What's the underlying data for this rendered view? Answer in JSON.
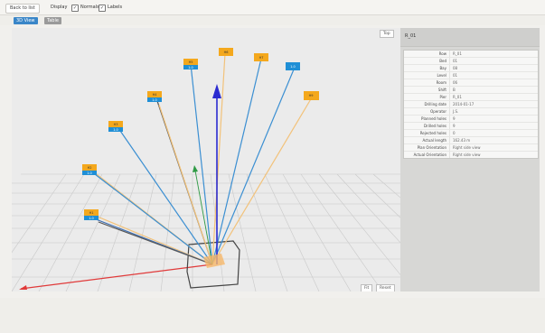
{
  "toolbar": {
    "back_label": "Back to list",
    "display_label": "Display",
    "checkbox_1": "Normals",
    "checkbox_2": "Labels"
  },
  "tabs": [
    {
      "label": "3D View"
    },
    {
      "label": "Table"
    }
  ],
  "viewport": {
    "corner_button": "Top",
    "bottom_buttons": [
      "Fit",
      "Reset"
    ]
  },
  "properties": {
    "header_title": "R_01",
    "rows": [
      {
        "k": "Row",
        "v": "R_01"
      },
      {
        "k": "Bed",
        "v": "01"
      },
      {
        "k": "Bay",
        "v": "08"
      },
      {
        "k": "Level",
        "v": "01"
      },
      {
        "k": "Room",
        "v": "06"
      },
      {
        "k": "Shift",
        "v": "B"
      },
      {
        "k": "Pier",
        "v": "R_01"
      },
      {
        "k": "Drilling date",
        "v": "2014-01-17"
      },
      {
        "k": "Operator",
        "v": "J.S."
      },
      {
        "k": "Planned holes",
        "v": "9"
      },
      {
        "k": "Drilled holes",
        "v": "9"
      },
      {
        "k": "Rejected holes",
        "v": "0"
      },
      {
        "k": "Actual length",
        "v": "162.43 m"
      },
      {
        "k": "Plan Orientation",
        "v": "Right side view"
      },
      {
        "k": "Actual Orientation",
        "v": "Right side view"
      }
    ]
  },
  "holes": [
    {
      "top": "H1",
      "bot": "1.0"
    },
    {
      "top": "H2",
      "bot": "1.0"
    },
    {
      "top": "H3",
      "bot": "1.0"
    },
    {
      "top": "H4",
      "bot": "1.0"
    },
    {
      "top": "H5",
      "bot": "1.0"
    },
    {
      "top": "H6",
      "bot": ""
    },
    {
      "top": "H7",
      "bot": ""
    },
    {
      "top": "",
      "bot": "1.0"
    },
    {
      "top": "H9",
      "bot": ""
    }
  ],
  "colors": {
    "accent": "#3a86c8",
    "orange": "#f4a81d",
    "blue": "#1f8fd6",
    "axis_x": "#e03a3a",
    "axis_y": "#2b2bd0",
    "axis_z": "#2e9a44"
  }
}
